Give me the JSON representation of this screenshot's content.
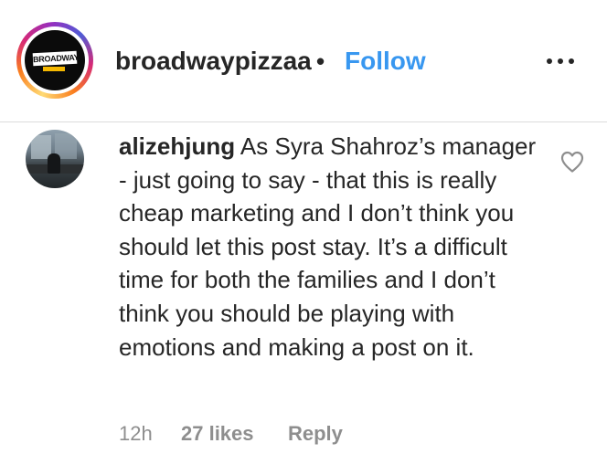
{
  "header": {
    "avatar_logo_text": "BROADWAY",
    "username": "broadwaypizzaa",
    "separator": "•",
    "follow_label": "Follow",
    "more_icon": "more-horizontal-icon"
  },
  "comment": {
    "avatar_icon": "user-avatar",
    "username": "alizehjung",
    "text": "As Syra Shahroz’s manager - just going to say - that this is really cheap marketing and I don’t think you should let this post stay. It’s a difficult time for both the families and I don’t think you should be playing with emotions and making a post on it.",
    "like_icon": "heart-outline-icon",
    "time": "12h",
    "likes": "27 likes",
    "reply_label": "Reply"
  },
  "colors": {
    "link_blue": "#3897f0",
    "text": "#262626",
    "muted": "#8e8e8e",
    "divider": "#dbdbdb"
  }
}
